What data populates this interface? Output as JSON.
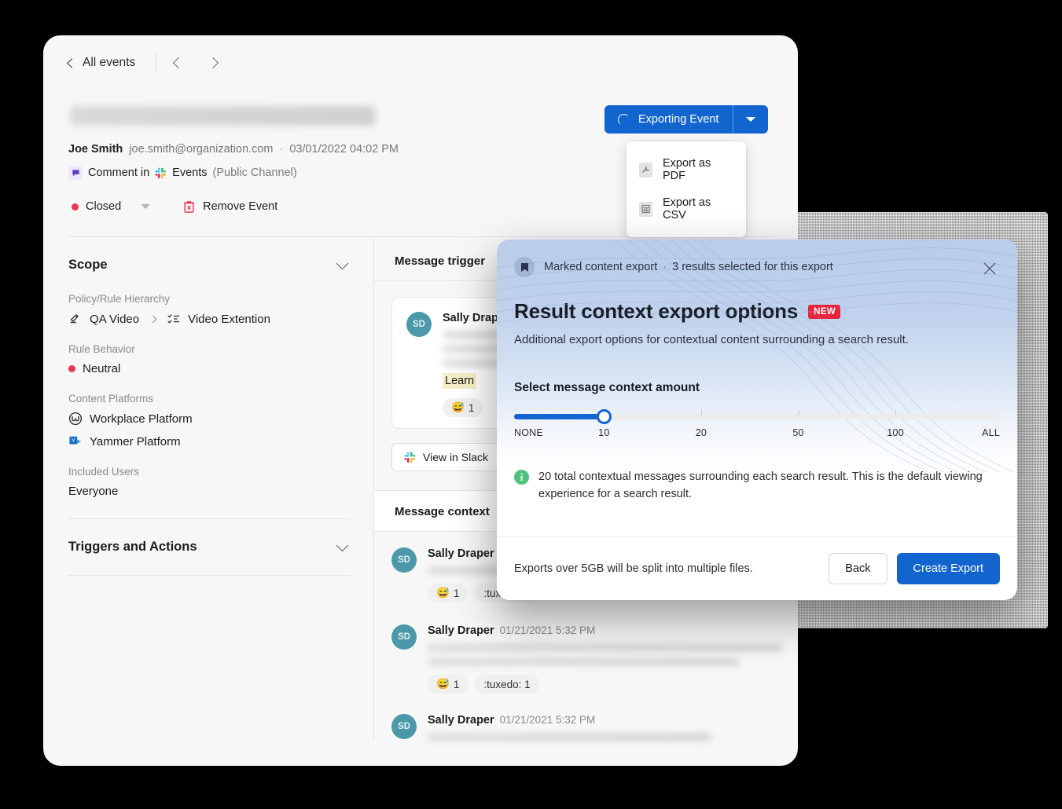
{
  "topbar": {
    "back_label": "All events",
    "prev_icon": "chevron-left-icon",
    "next_icon": "chevron-right-icon"
  },
  "event": {
    "author_name": "Joe Smith",
    "author_email": "joe.smith@organization.com",
    "separator": "·",
    "timestamp": "03/01/2022 04:02 PM",
    "channel_prefix": "Comment in",
    "channel_name": "Events",
    "channel_type": "(Public Channel)",
    "status_label": "Closed",
    "status_color": "#e8384f",
    "remove_label": "Remove Event"
  },
  "export_button": {
    "label": "Exporting Event",
    "spinner_icon": "loading-spinner-icon",
    "caret_icon": "caret-down-icon",
    "accent": "#1264cf",
    "menu": [
      {
        "label": "Export as PDF",
        "icon": "pdf-file-icon"
      },
      {
        "label": "Export as CSV",
        "icon": "csv-file-icon"
      }
    ]
  },
  "scope": {
    "title": "Scope",
    "fields": [
      {
        "label": "Policy/Rule Hierarchy"
      },
      {
        "label": "Rule Behavior"
      },
      {
        "label": "Content Platforms"
      },
      {
        "label": "Included Users"
      }
    ],
    "hierarchy": {
      "parent": "QA Video",
      "child": "Video Extention"
    },
    "rule_behavior": "Neutral",
    "rule_behavior_color": "#e8384f",
    "platforms": [
      {
        "label": "Workplace Platform",
        "icon": "workplace-icon"
      },
      {
        "label": "Yammer Platform",
        "icon": "yammer-icon"
      }
    ],
    "included_users": "Everyone"
  },
  "triggers_section": {
    "title": "Triggers and Actions"
  },
  "right_panel": {
    "trigger_header": "Message trigger",
    "context_header": "Message context",
    "view_in_slack": "View in Slack",
    "trigger_message": {
      "author": "Sally Draper",
      "initials": "SD",
      "highlight": "Learn",
      "reactions": [
        {
          "emoji": "😅",
          "count": "1"
        }
      ]
    },
    "context_messages": [
      {
        "author": "Sally Draper",
        "initials": "SD",
        "timestamp": "",
        "reactions": [
          {
            "emoji": "😅",
            "count": "1"
          },
          {
            "label": ":tuxedo: 1"
          }
        ]
      },
      {
        "author": "Sally Draper",
        "initials": "SD",
        "timestamp": "01/21/2021 5:32 PM",
        "reactions": [
          {
            "emoji": "😅",
            "count": "1"
          },
          {
            "label": ":tuxedo: 1"
          }
        ]
      },
      {
        "author": "Sally Draper",
        "initials": "SD",
        "timestamp": "01/21/2021 5:32 PM",
        "reactions": []
      }
    ]
  },
  "modal": {
    "eyebrow_icon": "bookmark-icon",
    "eyebrow_label": "Marked content export",
    "eyebrow_separator": "·",
    "eyebrow_count": "3 results selected for this export",
    "close_icon": "close-icon",
    "title": "Result context export options",
    "badge": "NEW",
    "badge_color": "#e8243c",
    "subtitle": "Additional export options for contextual content surrounding a search result.",
    "slider_title": "Select message context amount",
    "slider": {
      "value": "10",
      "fill_percent": 18.5,
      "ticks": [
        {
          "label": "NONE",
          "pos": 0
        },
        {
          "label": "10",
          "pos": 18.5
        },
        {
          "label": "20",
          "pos": 38.5
        },
        {
          "label": "50",
          "pos": 58.5
        },
        {
          "label": "100",
          "pos": 78.5
        },
        {
          "label": "ALL",
          "pos": 100
        }
      ]
    },
    "info_icon": "info-icon",
    "info_text": "20 total contextual messages surrounding each search result. This is the default viewing experience for a search result.",
    "footer_note": "Exports over 5GB will be split into multiple files.",
    "back_label": "Back",
    "primary_label": "Create Export"
  }
}
